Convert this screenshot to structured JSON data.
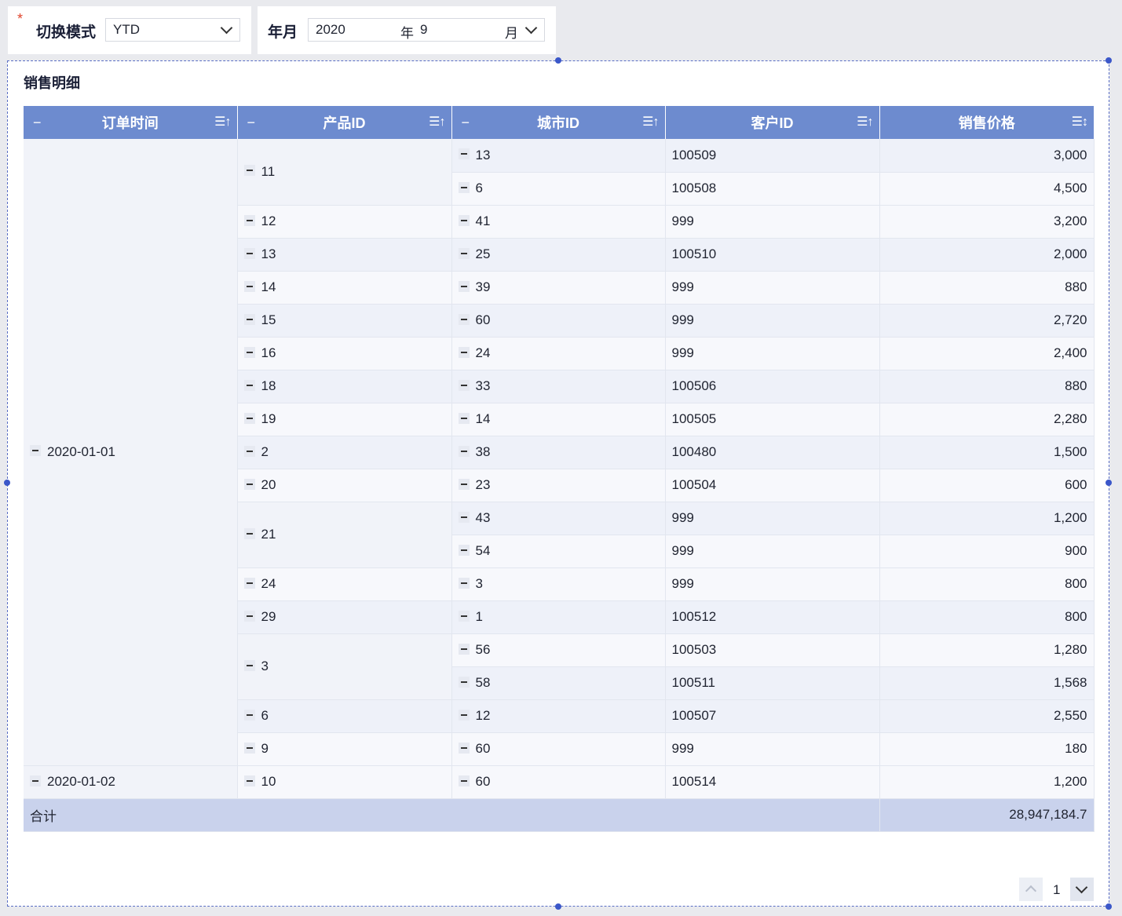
{
  "filters": {
    "mode_required_mark": "*",
    "mode_label": "切换模式",
    "mode_value": "YTD",
    "ym_label": "年月",
    "year_value": "2020",
    "year_unit": "年",
    "month_value": "9",
    "month_unit": "月"
  },
  "widget": {
    "title": "销售明细",
    "columns": [
      "订单时间",
      "产品ID",
      "城市ID",
      "客户ID",
      "销售价格"
    ],
    "collapse_symbol": "−",
    "sort_symbol": "☰↑",
    "sort_symbol_desc": "☰↕",
    "dates": [
      "2020-01-01",
      "2020-01-02"
    ],
    "products": [
      "11",
      "12",
      "13",
      "14",
      "15",
      "16",
      "18",
      "19",
      "2",
      "20",
      "21",
      "24",
      "29",
      "3",
      "6",
      "9",
      "10"
    ],
    "rows": [
      {
        "city": "13",
        "customer": "100509",
        "price": "3,000"
      },
      {
        "city": "6",
        "customer": "100508",
        "price": "4,500"
      },
      {
        "city": "41",
        "customer": "999",
        "price": "3,200"
      },
      {
        "city": "25",
        "customer": "100510",
        "price": "2,000"
      },
      {
        "city": "39",
        "customer": "999",
        "price": "880"
      },
      {
        "city": "60",
        "customer": "999",
        "price": "2,720"
      },
      {
        "city": "24",
        "customer": "999",
        "price": "2,400"
      },
      {
        "city": "33",
        "customer": "100506",
        "price": "880"
      },
      {
        "city": "14",
        "customer": "100505",
        "price": "2,280"
      },
      {
        "city": "38",
        "customer": "100480",
        "price": "1,500"
      },
      {
        "city": "23",
        "customer": "100504",
        "price": "600"
      },
      {
        "city": "43",
        "customer": "999",
        "price": "1,200"
      },
      {
        "city": "54",
        "customer": "999",
        "price": "900"
      },
      {
        "city": "3",
        "customer": "999",
        "price": "800"
      },
      {
        "city": "1",
        "customer": "100512",
        "price": "800"
      },
      {
        "city": "56",
        "customer": "100503",
        "price": "1,280"
      },
      {
        "city": "58",
        "customer": "100511",
        "price": "1,568"
      },
      {
        "city": "12",
        "customer": "100507",
        "price": "2,550"
      },
      {
        "city": "60",
        "customer": "999",
        "price": "180"
      },
      {
        "city": "60",
        "customer": "100514",
        "price": "1,200"
      }
    ],
    "total_label": "合计",
    "total_value": "28,947,184.7"
  },
  "pager": {
    "current_page": "1"
  },
  "colors": {
    "header_bg": "#6d8bcf",
    "total_bg": "#c9d2ec",
    "selection_border": "#3b57c9"
  }
}
